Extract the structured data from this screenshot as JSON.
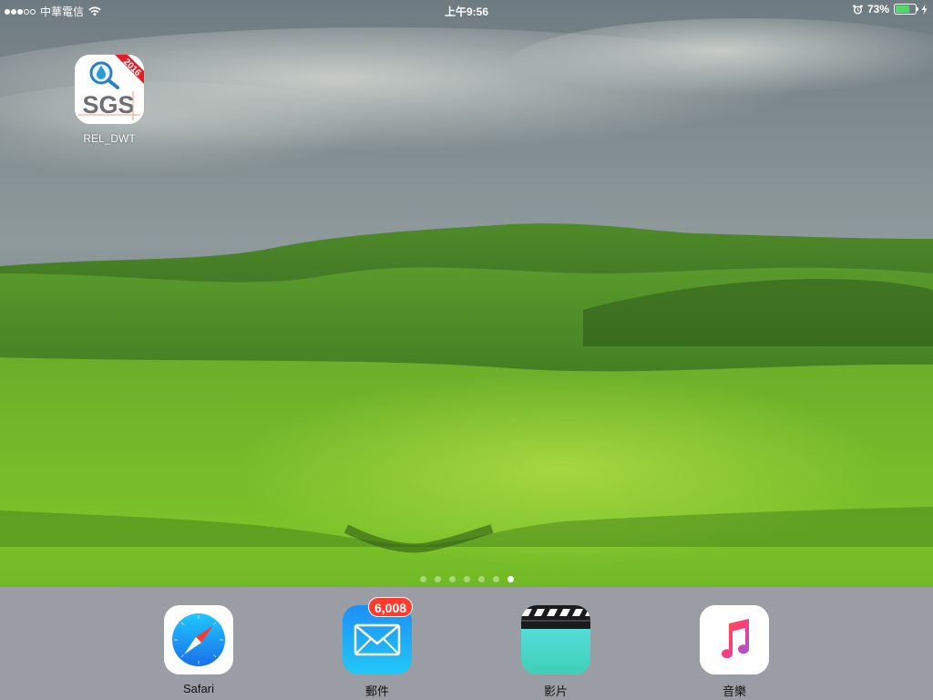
{
  "status_bar": {
    "signal_dots_filled": 3,
    "signal_dots_total": 5,
    "carrier": "中華電信",
    "time": "上午9:56",
    "battery_percent": "73%",
    "battery_level": 0.73,
    "icons": [
      "wifi-icon",
      "alarm-icon",
      "battery-icon",
      "charging-icon"
    ]
  },
  "home_apps": [
    {
      "label": "REL_DWT",
      "icon": "sgs-app-icon",
      "logo_text": "SGS",
      "ribbon_text": "2016"
    }
  ],
  "page_indicator": {
    "total": 7,
    "current": 7
  },
  "dock": {
    "apps": [
      {
        "label": "Safari",
        "icon": "safari-icon"
      },
      {
        "label": "郵件",
        "icon": "mail-icon",
        "badge": "6,008"
      },
      {
        "label": "影片",
        "icon": "videos-icon"
      },
      {
        "label": "音樂",
        "icon": "music-icon"
      }
    ]
  },
  "colors": {
    "badge": "#ff3b30",
    "battery_fill": "#4cd964",
    "safari_blue": "#1a8cff",
    "mail_blue": "#1e90ff",
    "music_pink": "#fc3c7a"
  }
}
